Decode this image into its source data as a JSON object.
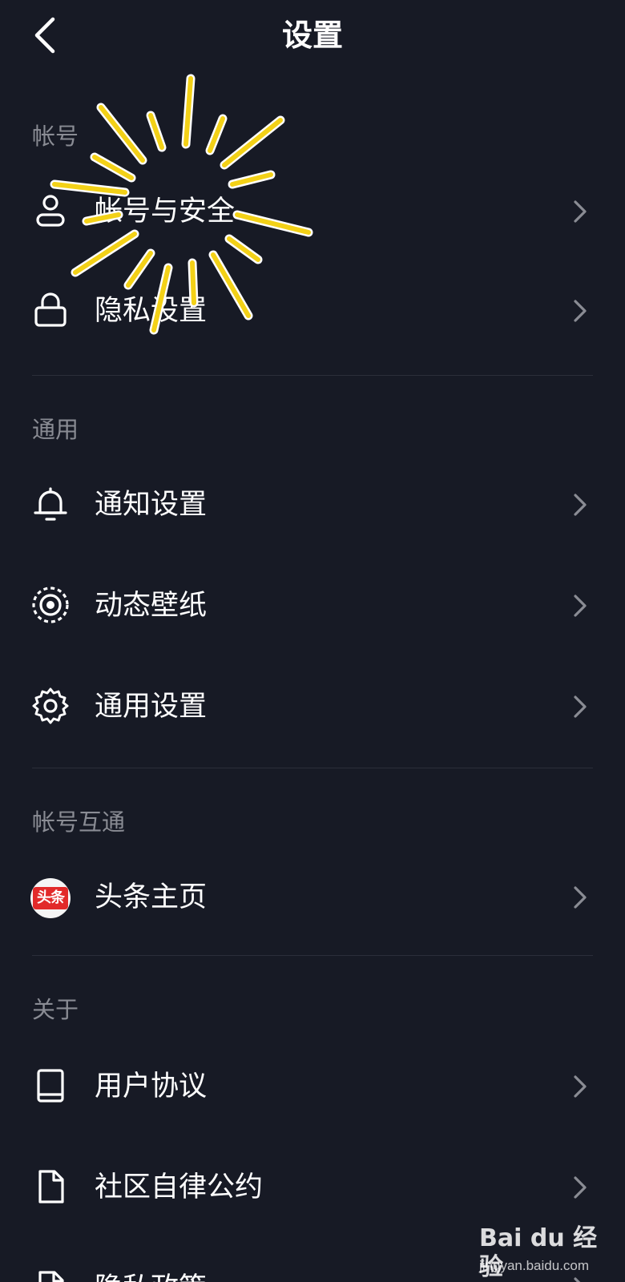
{
  "header": {
    "title": "设置",
    "back_icon": "chevron-left-icon"
  },
  "sections": {
    "account": {
      "label": "帐号",
      "items": [
        {
          "label": "帐号与安全",
          "icon": "user-icon"
        },
        {
          "label": "隐私设置",
          "icon": "lock-icon"
        }
      ]
    },
    "general": {
      "label": "通用",
      "items": [
        {
          "label": "通知设置",
          "icon": "bell-icon"
        },
        {
          "label": "动态壁纸",
          "icon": "live-wallpaper-icon"
        },
        {
          "label": "通用设置",
          "icon": "gear-icon"
        }
      ]
    },
    "linked": {
      "label": "帐号互通",
      "items": [
        {
          "label": "头条主页",
          "icon": "toutiao-logo-icon",
          "logo_text": "头条"
        }
      ]
    },
    "about": {
      "label": "关于",
      "items": [
        {
          "label": "用户协议",
          "icon": "book-icon"
        },
        {
          "label": "社区自律公约",
          "icon": "document-icon"
        },
        {
          "label": "隐私政策",
          "icon": "document-icon"
        }
      ]
    }
  },
  "watermark": {
    "logo": "Bai du 经验",
    "url": "jingyan.baidu.com"
  },
  "colors": {
    "background": "#171a25",
    "section_label": "#8a8c94",
    "divider": "#2b2e3a",
    "highlight": "#f3d117"
  }
}
